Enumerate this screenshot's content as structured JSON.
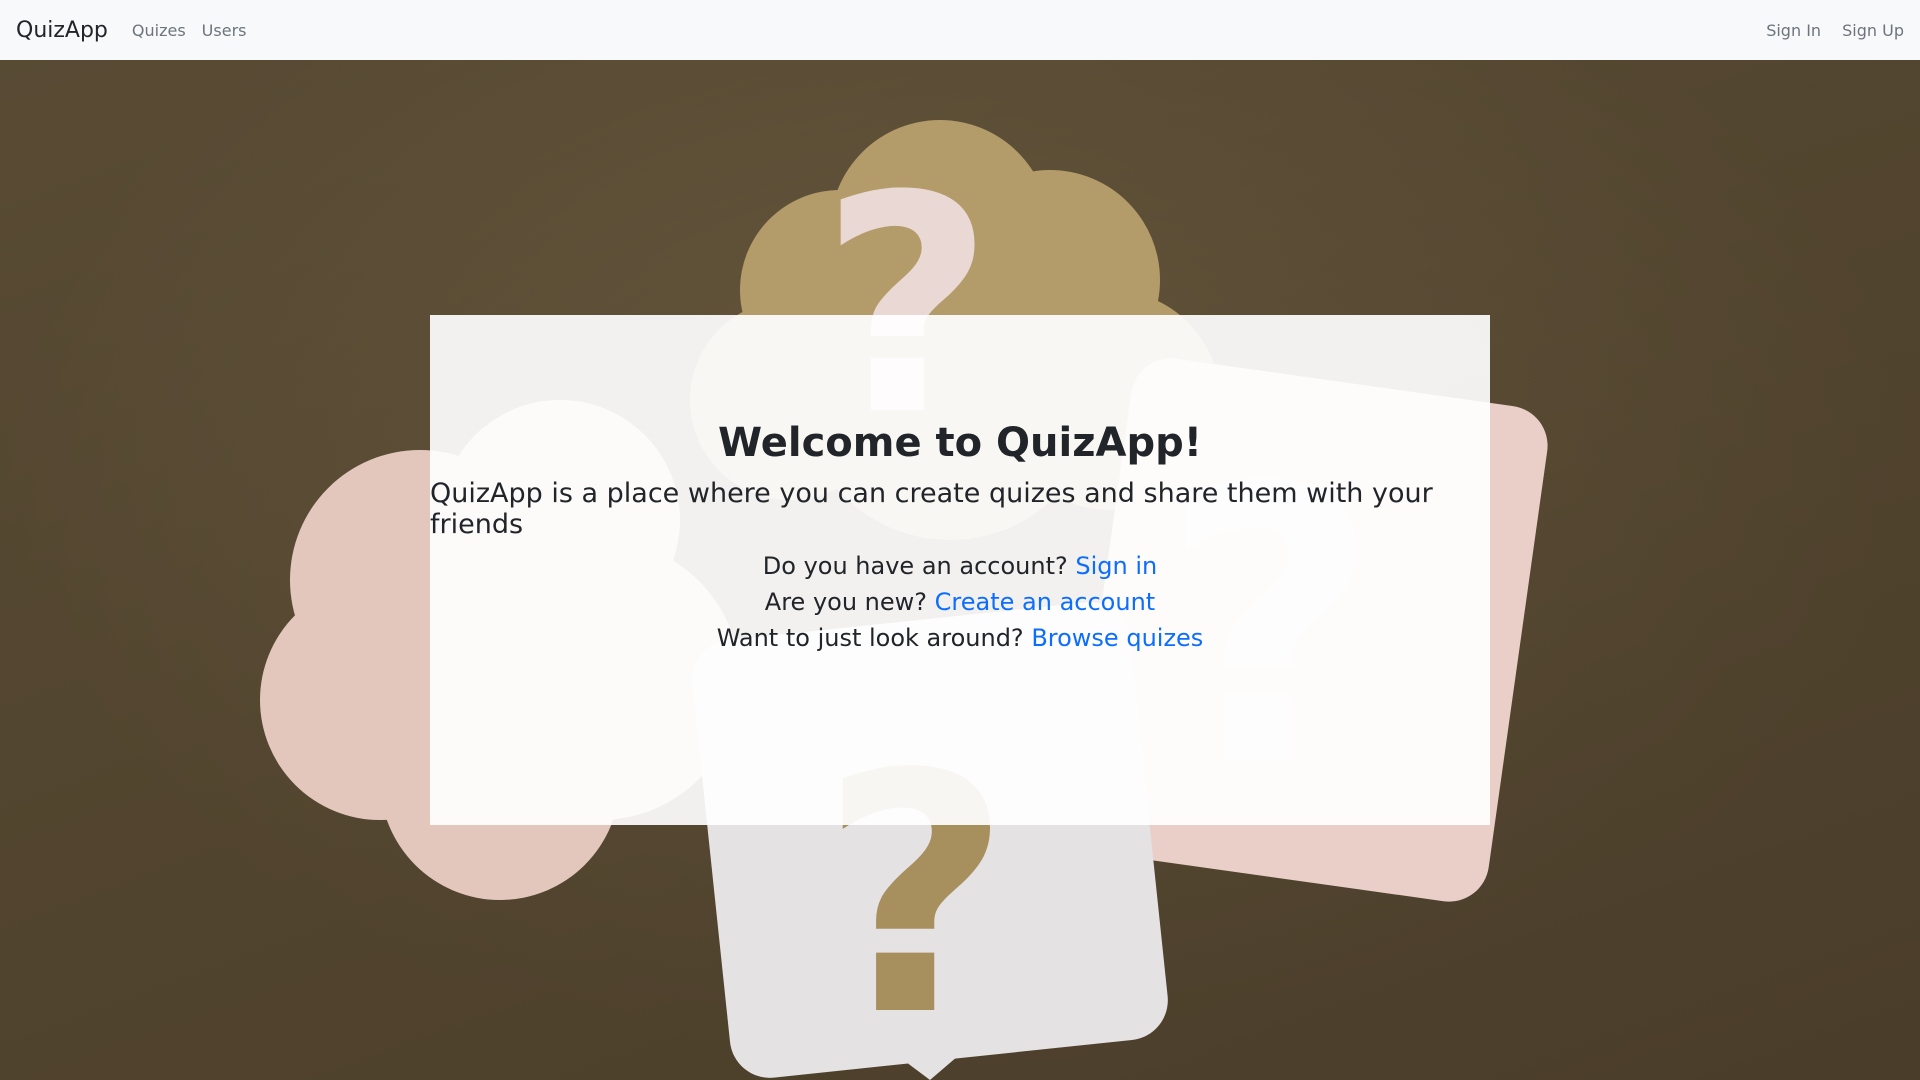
{
  "nav": {
    "brand": "QuizApp",
    "left_links": [
      "Quizes",
      "Users"
    ],
    "right_links": [
      "Sign In",
      "Sign Up"
    ],
    "progress_fraction": 0.2
  },
  "hero": {
    "title": "Welcome to QuizApp!",
    "subtitle": "QuizApp is a place where you can create quizes and share them with your friends",
    "lines": [
      {
        "text": "Do you have an account?",
        "link": "Sign in"
      },
      {
        "text": "Are you new?",
        "link": "Create an account"
      },
      {
        "text": "Want to just look around?",
        "link": "Browse quizes"
      }
    ]
  },
  "colors": {
    "navbar_bg": "#f8f9fa",
    "link": "#0d6efd",
    "text": "#212529",
    "muted": "#6c757d"
  }
}
